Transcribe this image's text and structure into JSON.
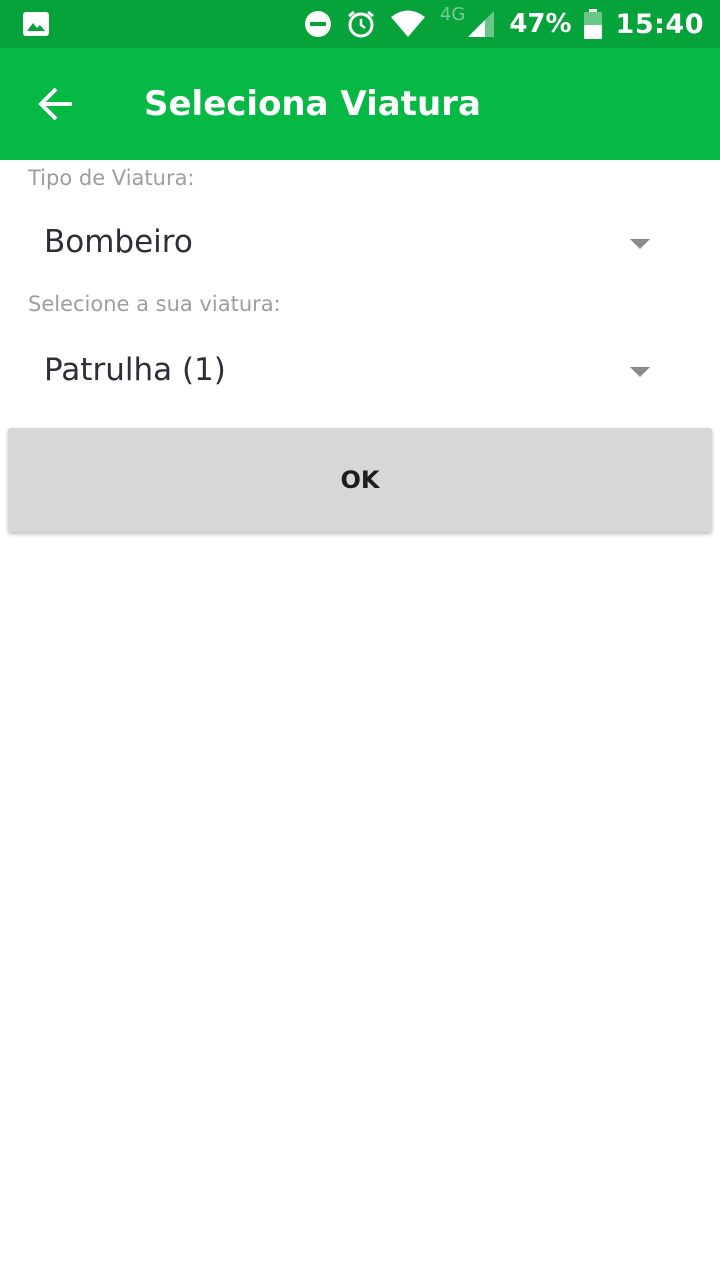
{
  "status_bar": {
    "network_label": "4G",
    "battery": "47%",
    "time": "15:40",
    "icons": [
      "gallery-icon",
      "do-not-disturb-icon",
      "alarm-icon",
      "wifi-icon",
      "cell-signal-icon",
      "battery-icon"
    ]
  },
  "app_bar": {
    "title": "Seleciona Viatura",
    "back_icon": "arrow-back-icon"
  },
  "form": {
    "vehicle_type_label": "Tipo de Viatura:",
    "vehicle_type_value": "Bombeiro",
    "vehicle_label": "Selecione a sua viatura:",
    "vehicle_value": "Patrulha (1)",
    "ok_label": "OK"
  },
  "colors": {
    "status_bar": "#06a33a",
    "app_bar": "#06b844",
    "button": "#d7d7d7",
    "label": "#9e9e9e",
    "value_text": "#2e2e3a"
  }
}
